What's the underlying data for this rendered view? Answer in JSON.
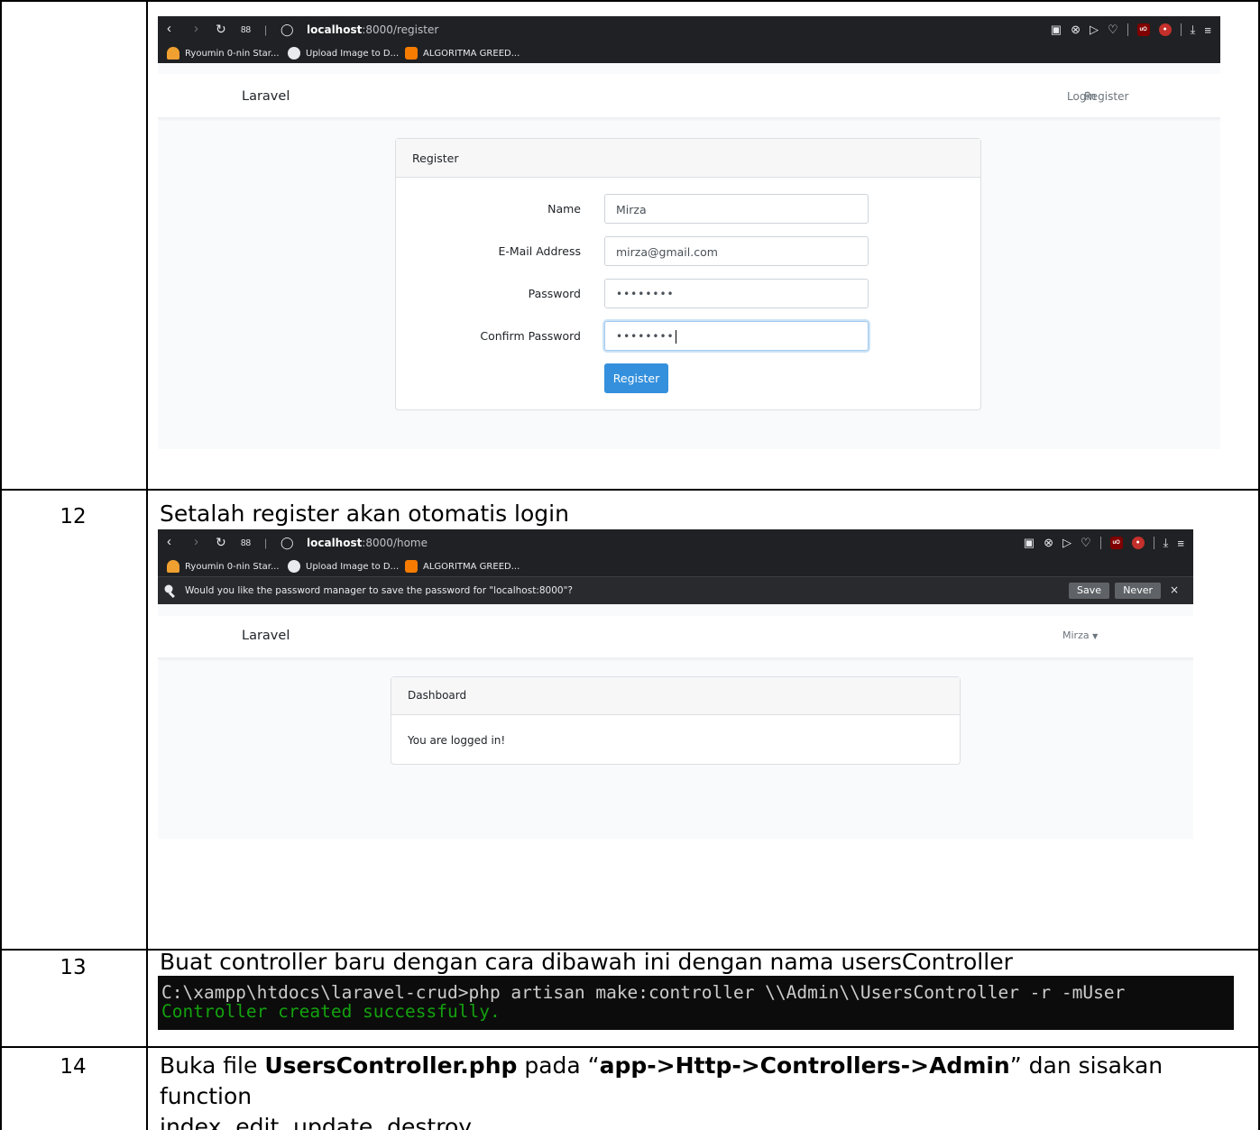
{
  "rows": [
    {
      "number": "",
      "text": ""
    },
    {
      "number": "12",
      "text": "Setalah register akan otomatis login"
    },
    {
      "number": "13",
      "text": "Buat controller baru dengan cara dibawah ini dengan nama usersController"
    },
    {
      "number": "14",
      "text_parts": {
        "p1": "Buka file ",
        "b1": "UsersController.php",
        "p2": " pada “",
        "b2": "app->Http->Controllers->Admin",
        "p3": "” dan sisakan function",
        "line2": "index, edit, update, destroy"
      }
    }
  ],
  "browser": {
    "bookmarks": [
      {
        "label": "Ryoumin 0-nin Star...",
        "color": "#f0a030"
      },
      {
        "label": "Upload Image to D...",
        "color": "#e8eaed"
      },
      {
        "label": "ALGORITMA GREED...",
        "color": "#f57c00"
      }
    ],
    "grid_icon": "88",
    "colors": {
      "chrome": "#202124",
      "accent": "#3490dc"
    }
  },
  "shot1": {
    "url_host": "localhost",
    "url_path": ":8000/register",
    "brand": "Laravel",
    "nav_login": "Login",
    "nav_register": "Register",
    "card_title": "Register",
    "form": {
      "name_label": "Name",
      "name_value": "Mirza",
      "email_label": "E-Mail Address",
      "email_value": "mirza@gmail.com",
      "password_label": "Password",
      "password_value": "••••••••",
      "confirm_label": "Confirm Password",
      "confirm_value": "••••••••",
      "submit_label": "Register"
    }
  },
  "shot2": {
    "url_host": "localhost",
    "url_path": ":8000/home",
    "password_prompt": "Would you like the password manager to save the password for \"localhost:8000\"?",
    "save_label": "Save",
    "never_label": "Never",
    "close_glyph": "×",
    "brand": "Laravel",
    "user_menu": "Mirza",
    "card_title": "Dashboard",
    "card_body": "You are logged in!"
  },
  "terminal": {
    "line1": "C:\\xampp\\htdocs\\laravel-crud>php artisan make:controller \\\\Admin\\\\UsersController -r -mUser",
    "line2": "Controller created successfully.",
    "colors": {
      "text": "#cccccc",
      "success": "#13a10e"
    }
  }
}
